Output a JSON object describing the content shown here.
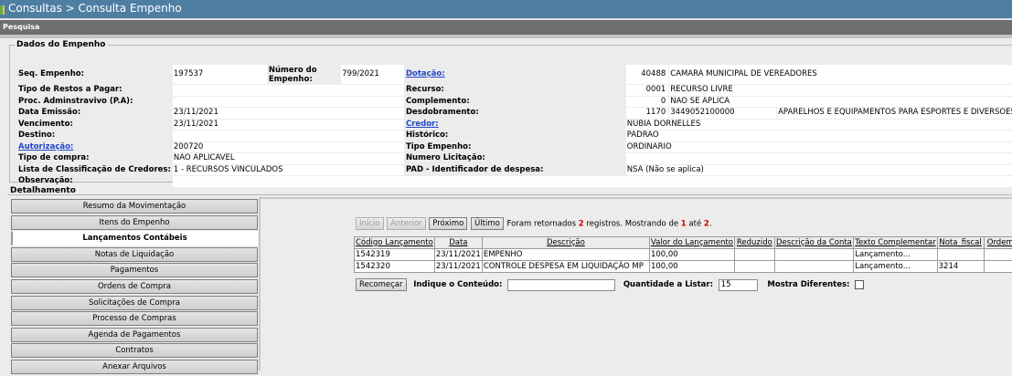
{
  "header": {
    "title": "Consultas > Consulta Empenho"
  },
  "subheader": {
    "title": "Pesquisa"
  },
  "dados": {
    "legend": "Dados do Empenho",
    "seq_label": "Seq. Empenho:",
    "seq_value": "197537",
    "numero_label": "Número do Empenho:",
    "numero_value": "799/2021",
    "dotacao_label": "Dotação:",
    "dotacao_code": "40488",
    "dotacao_desc": "CAMARA MUNICIPAL DE VEREADORES",
    "tipo_restos_label": "Tipo de Restos a Pagar:",
    "recurso_label": "Recurso:",
    "recurso_code": "0001",
    "recurso_desc": "RECURSO LIVRE",
    "proc_label": "Proc. Adminstravivo (P.A):",
    "complemento_label": "Complemento:",
    "complemento_code": "0",
    "complemento_desc": "NÃO SE APLICA",
    "data_emissao_label": "Data Emissão:",
    "data_emissao_value": "23/11/2021",
    "desdobramento_label": "Desdobramento:",
    "desdobramento_code": "1170",
    "desdobramento_num": "3449052100000",
    "desdobramento_desc": "APARELHOS E EQUIPAMENTOS PARA ESPORTES E DIVERSÕES",
    "vencimento_label": "Vencimento:",
    "vencimento_value": "23/11/2021",
    "credor_label": "Credor:",
    "credor_value": "NÚBIA DORNELLES",
    "destino_label": "Destino:",
    "historico_label": "Histórico:",
    "historico_value": "PADRÃO",
    "autorizacao_label": "Autorização:",
    "autorizacao_value": "200720",
    "tipo_empenho_label": "Tipo Empenho:",
    "tipo_empenho_value": "ORDINÁRIO",
    "tipo_compra_label": "Tipo de compra:",
    "tipo_compra_value": "NÃO APLICÁVEL",
    "numero_licitacao_label": "Numero Licitação:",
    "lista_label": "Lista de Classificação de Credores:",
    "lista_value": "1 - RECURSOS VINCULADOS",
    "pad_label": "PAD - Identificador de despesa:",
    "pad_value": "NSA (Não se aplica)",
    "observacao_label": "Observação:"
  },
  "detalhamento": {
    "title": "Detalhamento",
    "menu": [
      "Resumo da Movimentação",
      "Itens do Empenho",
      "Lançamentos Contábeis",
      "Notas de Liquidação",
      "Pagamentos",
      "Ordens de Compra",
      "Solicitações de Compra",
      "Processo de Compras",
      "Agenda de Pagamentos",
      "Contratos",
      "Anexar Arquivos"
    ],
    "active_index": 2
  },
  "pager": {
    "first": "Início",
    "prev": "Anterior",
    "next": "Próximo",
    "last": "Último",
    "text1": "Foram retornados",
    "count": "2",
    "text2": "registros. Mostrando de",
    "from": "1",
    "text3": "até",
    "to": "2",
    "dot": "."
  },
  "grid": {
    "columns": [
      "Código Lançamento",
      "Data",
      "Descrição",
      "Valor do Lançamento",
      "Reduzido",
      "Descrição da Conta",
      "Texto Complementar",
      "Nota_fiscal",
      "Ordem"
    ],
    "rows": [
      [
        "1542319",
        "23/11/2021",
        "EMPENHO",
        "100,00",
        "",
        "",
        "Lançamento...",
        "",
        ""
      ],
      [
        "1542320",
        "23/11/2021",
        "CONTROLE DESPESA EM LIQUIDAÇÃO MP",
        "100,00",
        "",
        "",
        "Lançamento...",
        "3214",
        ""
      ]
    ]
  },
  "filter": {
    "recomecar": "Recomeçar",
    "indique_label": "Indique o Conteúdo:",
    "indique_value": "",
    "quantidade_label": "Quantidade a Listar:",
    "quantidade_value": "15",
    "mostra_label": "Mostra Diferentes:"
  }
}
